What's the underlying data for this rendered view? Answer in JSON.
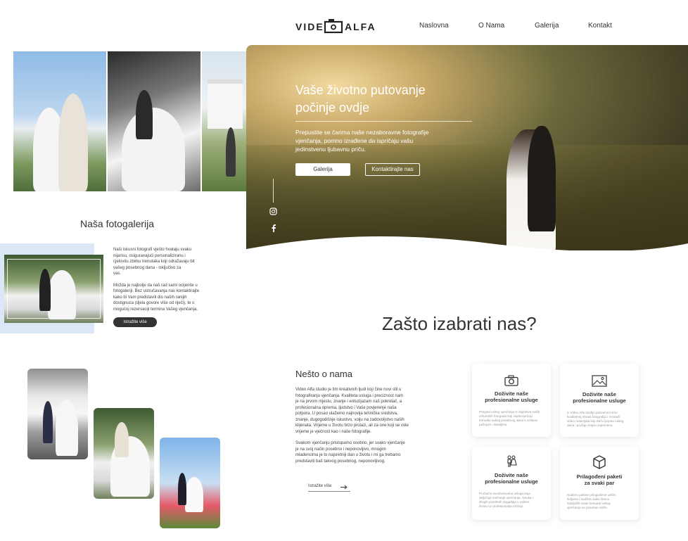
{
  "header": {
    "logo_left": "VIDE",
    "logo_right": "ALFA",
    "nav": [
      "Naslovna",
      "O Nama",
      "Galerija",
      "Kontakt"
    ]
  },
  "hero": {
    "title_line1": "Vaše životno putovanje",
    "title_line2": "počinje ovdje",
    "text_line1": "Prepustite se čarima naše nezaboravne fotografije",
    "text_line2": "vjenčanja, pomno izrađene da ispričaju vašu",
    "text_line3": "jedinstvenu ljubavnu priču.",
    "btn_gallery": "Galerija",
    "btn_contact": "Kontaktirajte nas",
    "social": [
      "instagram-icon",
      "facebook-icon"
    ]
  },
  "gallery": {
    "title": "Naša fotogalerija",
    "p1": [
      "Naši iskusni fotografi vješto hvataju svaku",
      "nijansu, osiguravajući personaliziranu i",
      "cjelovitu zbirku trenutaka koji odražavaju bit",
      "vašeg posebnog dana - isključivo za",
      "vas."
    ],
    "p2": [
      "Možda je najbolje da naš rad sami ocijenite u",
      "fotogaleriji. Bez ustručavanja nas kontaktirajte",
      "kako bi Vam predstavili dio naših ranijih",
      "dostignuća (djela govore više od riječi), te o",
      "mogućoj rezervaciji termina Vašeg vjenčanja."
    ],
    "button": "Istražite više"
  },
  "why": {
    "title": "Zašto izabrati nas?"
  },
  "about": {
    "title": "Nešto o nama",
    "p1": [
      "Video Alfa studio je tim kreativnih ljudi koji čine novi stil u",
      "fotografiranju vjenčanja. Kvaliteta usluga i preciznost nam",
      "je na prvom mjestu, znanje i entuzijazam naš pokretač, a",
      "profesionalna oprema, ljudstvo i Vaše povjerenje naša",
      "potpora. U posao ulažemo najnovija tehnička sredstva,",
      "znanje, dugogodišnje iskustvo, volju na zadovoljstvo naših",
      "klijenata. Vrijeme u životu brzo prolazi, ali za one koji se vole",
      "vrijeme je vječnost kao i naše fotografije."
    ],
    "p2": [
      "Svakom vjenčanju pristupamo osobno, jer svako vjenčanje",
      "je na svoj način posebno i neponovljivo, mnogim",
      "mladencima je to najsretniji dan u životu i mi ga trebamo",
      "predstaviti baš takvog posebnog, neponovljivog."
    ],
    "link": "Istražite više"
  },
  "cards": [
    {
      "icon": "camera-icon",
      "title_line1": "Doživite naše",
      "title_line2": "profesionalne usluge",
      "text": [
        "Pregled vašeg vjenčanja iz objektiva naših",
        "vrhunskih fotografa koji ovjekovječuju",
        "trenutke vašeg posebnog dana s velikom",
        "pažnjom i detaljima."
      ]
    },
    {
      "icon": "image-icon",
      "title_line1": "Doživite naše",
      "title_line2": "profesionalne usluge",
      "text": [
        "U Video Alfa studiju posvećeni smo",
        "kvalitetnoj obradi fotografija i montaži",
        "video materijala koji ističu ljepotu vašeg",
        "dana i pružaju trajnu uspomenu."
      ]
    },
    {
      "icon": "couple-icon",
      "title_line1": "Doživite naše",
      "title_line2": "profesionalne usluge",
      "text": [
        "Pružamo sveobuhvatnu uslugu koja",
        "uključuje snimanje vjenčanja, zaruka i",
        "drugih posebnih događaja u vašem",
        "životu uz profesionalan pristup."
      ]
    },
    {
      "icon": "box-icon",
      "title_line1": "Prilagođeni paketi",
      "title_line2": "za svaki par",
      "text": [
        "Nudimo pakete prilagođene vašim",
        "željama i budžetu kako bismo",
        "zabilježili svaki trenutak vašeg",
        "vjenčanja na poseban način."
      ]
    }
  ]
}
